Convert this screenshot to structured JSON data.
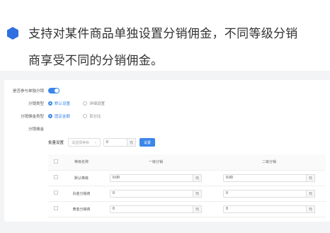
{
  "heading": {
    "line1": "支持对某件商品单独设置分销佣金，不同等级分销",
    "line2": "商享受不同的分销佣金。"
  },
  "form": {
    "participate": {
      "label": "是否参与单独分销",
      "enabled": true
    },
    "dist_type": {
      "label": "分销类型",
      "options": [
        "默认设置",
        "详细设置"
      ],
      "selected": 0
    },
    "commission_type": {
      "label": "分销佣金类型",
      "options": [
        "固定金额",
        "百分比"
      ],
      "selected": 0
    },
    "commission": {
      "label": "分销佣金"
    }
  },
  "batch": {
    "label": "批量设置",
    "select_placeholder": "请选择等级",
    "value": "0",
    "unit": "元",
    "button": "设置"
  },
  "table": {
    "headers": [
      "等级名称",
      "一级分销",
      "二级分销"
    ],
    "rows": [
      {
        "name": "默认等级",
        "v1": "0.00",
        "u1": "元",
        "v2": "0.00",
        "u2": "元"
      },
      {
        "name": "白金分销商",
        "v1": "0",
        "u1": "元",
        "v2": "0",
        "u2": "元"
      },
      {
        "name": "黄金分销商",
        "v1": "0",
        "u1": "元",
        "v2": "0",
        "u2": "元"
      }
    ]
  },
  "colors": {
    "accent": "#3a86e9",
    "hex_icon": "#2f6fe0",
    "panel_bg": "#f3f4f6"
  }
}
